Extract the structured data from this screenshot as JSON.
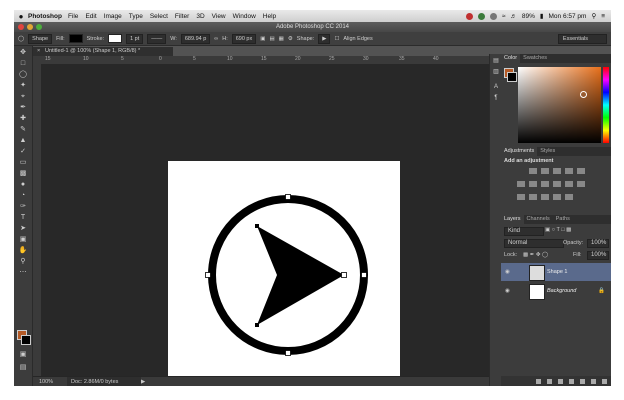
{
  "menubar": {
    "apple": "",
    "app": "Photoshop",
    "items": [
      "File",
      "Edit",
      "Image",
      "Type",
      "Select",
      "Filter",
      "3D",
      "View",
      "Window",
      "Help"
    ],
    "battery": "89%",
    "clock": "Mon 6:57 pm"
  },
  "titlebar": {
    "title": "Adobe Photoshop CC 2014"
  },
  "options": {
    "tool_mode": "Shape",
    "fill_label": "Fill:",
    "stroke_label": "Stroke:",
    "stroke_width": "1 pt",
    "w_label": "W:",
    "width_value": "689.94 p",
    "h_label": "H:",
    "height_value": "690 px",
    "shape_label": "Shape:",
    "align_edges": "Align Edges",
    "workspace": "Essentials"
  },
  "document": {
    "tab_title": "Untitled-1 @ 100% (Shape 1, RGB/8) *",
    "close": "×",
    "ruler_ticks": [
      "15",
      "10",
      "5",
      "0",
      "5",
      "10",
      "15",
      "20",
      "25",
      "30",
      "35",
      "40"
    ],
    "zoom": "100%",
    "doc_info": "Doc: 2.86M/0 bytes",
    "status_arrow": "▶"
  },
  "panels": {
    "color_tab": "Color",
    "swatches_tab": "Swatches",
    "adjustments_tab": "Adjustments",
    "styles_tab": "Styles",
    "add_adjustment": "Add an adjustment",
    "layers_tab": "Layers",
    "channels_tab": "Channels",
    "paths_tab": "Paths",
    "kind": "Kind",
    "blend_mode": "Normal",
    "opacity_label": "Opacity:",
    "opacity_value": "100%",
    "lock_label": "Lock:",
    "fill_label": "Fill:",
    "fill_value": "100%",
    "layers": [
      {
        "name": "Shape 1",
        "selected": true
      },
      {
        "name": "Background",
        "selected": false
      }
    ]
  },
  "colors": {
    "foreground": "#b55a26",
    "background": "#000000",
    "selected_layer": "#5a6a8c"
  }
}
